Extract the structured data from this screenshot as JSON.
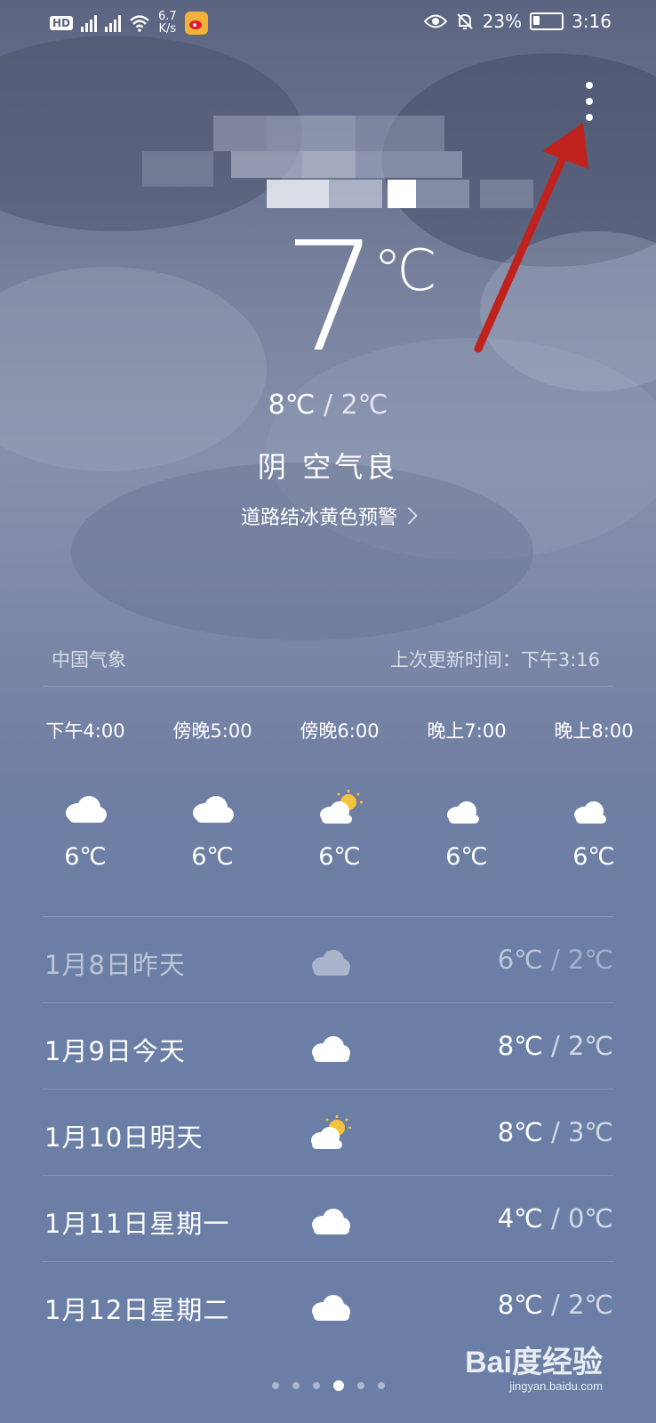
{
  "status_bar": {
    "hd": "HD",
    "network_speed": "6.7",
    "network_speed_unit": "K/s",
    "battery": "23%",
    "time": "3:16",
    "icons": [
      "hd-icon",
      "signal-2g-icon",
      "signal-4g-icon",
      "wifi-icon",
      "weibo-icon",
      "eye-icon",
      "bell-off-icon",
      "battery-icon"
    ]
  },
  "current": {
    "temperature": "7",
    "unit": "℃",
    "high": "8℃",
    "separator": "/",
    "low": "2℃",
    "condition": "阴  空气良",
    "warning": "道路结冰黄色预警"
  },
  "source": {
    "provider": "中国气象",
    "updated": "上次更新时间：下午3:16"
  },
  "hourly": [
    {
      "time": "下午4:00",
      "icon": "cloud-icon",
      "temp": "6℃"
    },
    {
      "time": "傍晚5:00",
      "icon": "cloud-icon",
      "temp": "6℃"
    },
    {
      "time": "傍晚6:00",
      "icon": "partly-sunny-icon",
      "temp": "6℃"
    },
    {
      "time": "晚上7:00",
      "icon": "cloudy-night-icon",
      "temp": "6℃"
    },
    {
      "time": "晚上8:00",
      "icon": "cloudy-night-icon",
      "temp": "6℃"
    }
  ],
  "daily": [
    {
      "date": "1月8日昨天",
      "icon": "cloud-icon",
      "high": "6℃",
      "low": "2℃"
    },
    {
      "date": "1月9日今天",
      "icon": "cloud-icon",
      "high": "8℃",
      "low": "2℃"
    },
    {
      "date": "1月10日明天",
      "icon": "partly-sunny-icon",
      "high": "8℃",
      "low": "3℃"
    },
    {
      "date": "1月11日星期一",
      "icon": "cloud-icon",
      "high": "4℃",
      "low": "0℃"
    },
    {
      "date": "1月12日星期二",
      "icon": "cloud-icon",
      "high": "8℃",
      "low": "2℃"
    }
  ],
  "pager": {
    "count": 6,
    "active": 4
  },
  "watermark": {
    "brand": "Bai度经验",
    "url": "jingyan.baidu.com"
  },
  "colors": {
    "background": "#6a7ea6",
    "annotation_arrow": "#c0231e"
  }
}
